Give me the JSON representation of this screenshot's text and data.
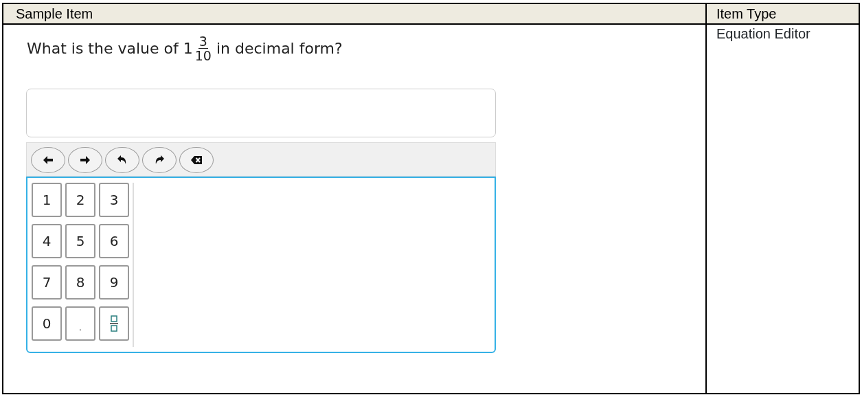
{
  "table": {
    "columns": [
      "Sample Item",
      "Item Type"
    ],
    "item_type": "Equation Editor",
    "question": {
      "before": "What is the value of",
      "whole": "1",
      "numerator": "3",
      "denominator": "10",
      "after": "in decimal form?"
    },
    "toolbar": [
      {
        "kind": "left"
      },
      {
        "kind": "right"
      },
      {
        "kind": "undo"
      },
      {
        "kind": "redo"
      },
      {
        "kind": "backspace"
      }
    ],
    "keys": [
      {
        "kind": "text",
        "label": "1"
      },
      {
        "kind": "text",
        "label": "2"
      },
      {
        "kind": "text",
        "label": "3"
      },
      {
        "kind": "text",
        "label": "4"
      },
      {
        "kind": "text",
        "label": "5"
      },
      {
        "kind": "text",
        "label": "6"
      },
      {
        "kind": "text",
        "label": "7"
      },
      {
        "kind": "text",
        "label": "8"
      },
      {
        "kind": "text",
        "label": "9"
      },
      {
        "kind": "text",
        "label": "0"
      },
      {
        "kind": "text",
        "label": "."
      },
      {
        "kind": "fraction"
      }
    ]
  }
}
